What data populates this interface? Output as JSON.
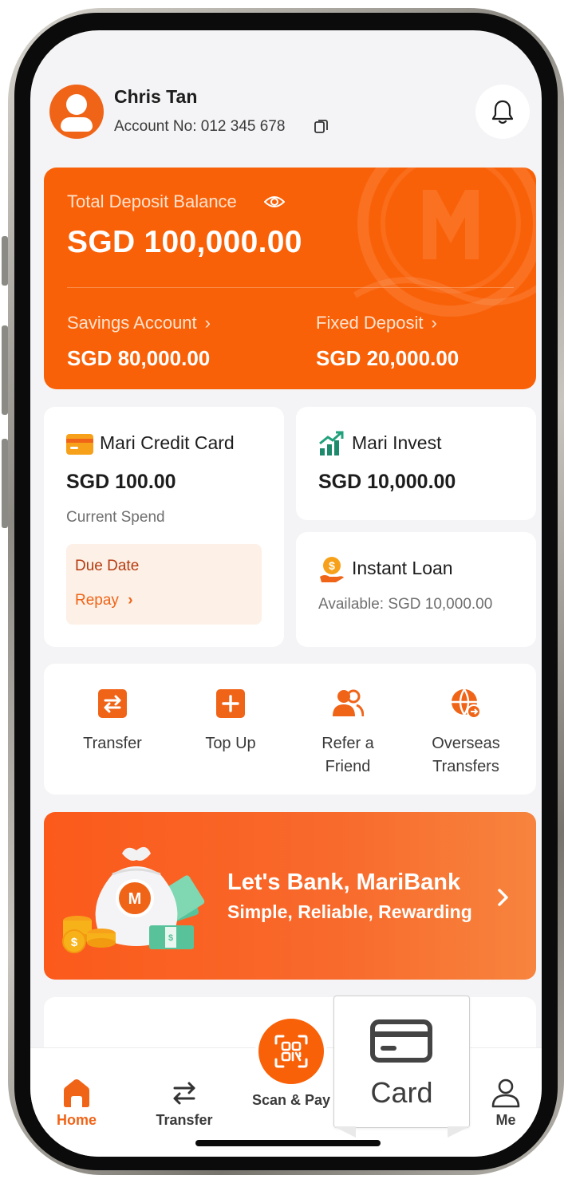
{
  "header": {
    "user_name": "Chris Tan",
    "account_label": "Account No: 012 345 678"
  },
  "balance": {
    "label": "Total Deposit Balance",
    "amount": "SGD 100,000.00",
    "savings_label": "Savings Account",
    "savings_amount": "SGD 80,000.00",
    "fixed_label": "Fixed Deposit",
    "fixed_amount": "SGD 20,000.00"
  },
  "credit_card": {
    "title": "Mari Credit Card",
    "amount": "SGD 100.00",
    "sub": "Current Spend",
    "due_label": "Due Date",
    "repay_label": "Repay"
  },
  "invest": {
    "title": "Mari Invest",
    "amount": "SGD 10,000.00"
  },
  "loan": {
    "title": "Instant Loan",
    "available": "Available: SGD 10,000.00"
  },
  "actions": [
    {
      "line1": "Transfer",
      "line2": "",
      "icon": "transfer-icon"
    },
    {
      "line1": "Top Up",
      "line2": "",
      "icon": "plus-icon"
    },
    {
      "line1": "Refer a",
      "line2": "Friend",
      "icon": "people-icon"
    },
    {
      "line1": "Overseas",
      "line2": "Transfers",
      "icon": "globe-icon"
    }
  ],
  "promo": {
    "title": "Let's Bank, MariBank",
    "subtitle": "Simple, Reliable, Rewarding",
    "badge": "M"
  },
  "nav": {
    "home": "Home",
    "transfer": "Transfer",
    "scan": "Scan & Pay",
    "me": "Me"
  },
  "card_popup": {
    "label": "Card"
  },
  "colors": {
    "primary": "#f96108",
    "accent_orange": "#f06418",
    "background": "#f4f4f6",
    "due_text": "#b53b10"
  }
}
